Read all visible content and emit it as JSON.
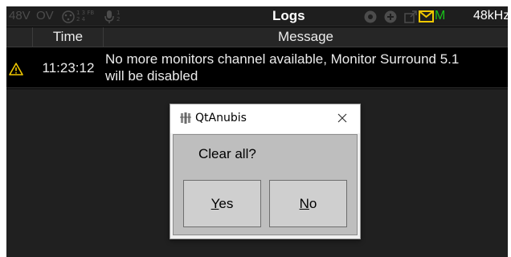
{
  "statusbar": {
    "phantom": "48V",
    "overload": "OV",
    "routing_top": "1 3 FB",
    "routing_bottom": "2 4",
    "mic_top": "1",
    "mic_bottom": "2",
    "title": "Logs",
    "mail_indicator": "M",
    "sample_rate": "48kHz",
    "accent_yellow": "#f0c800",
    "accent_green": "#19c019",
    "dim_color": "#4c4c4c"
  },
  "table": {
    "columns": [
      "Time",
      "Message"
    ],
    "rows": [
      {
        "icon": "warning-icon",
        "time": "11:23:12",
        "message_line1": "No more monitors channel available, Monitor  Surround 5.1",
        "message_line2": "will be disabled"
      }
    ]
  },
  "dialog": {
    "title": "QtAnubis",
    "question": "Clear all?",
    "yes_label": "Yes",
    "no_label": "No",
    "yes_mnemonic": "Y",
    "yes_rest": "es",
    "no_mnemonic": "N",
    "no_rest": "o"
  }
}
